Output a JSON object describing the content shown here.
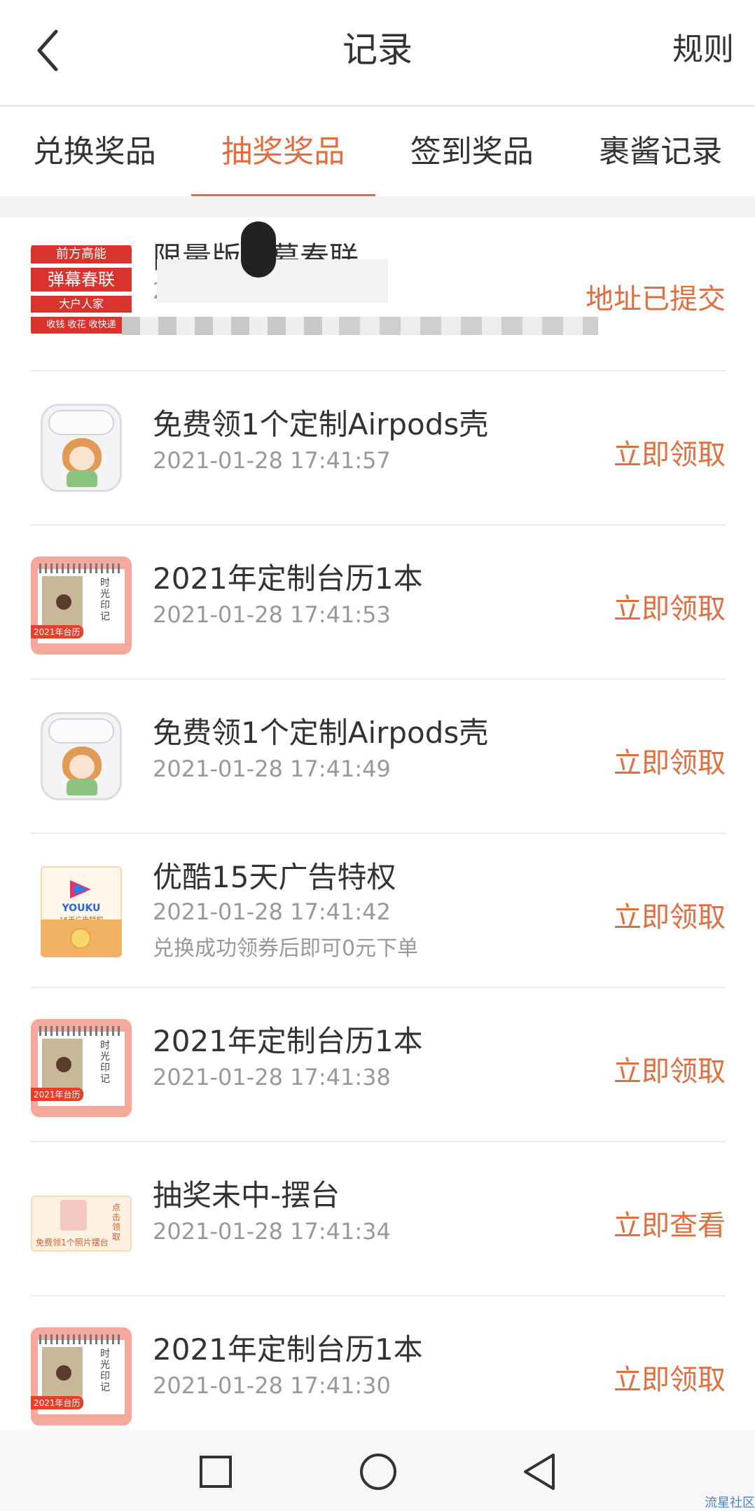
{
  "header": {
    "title": "记录",
    "rules_label": "规则"
  },
  "tabs": [
    {
      "label": "兑换奖品",
      "active": false
    },
    {
      "label": "抽奖奖品",
      "active": true
    },
    {
      "label": "签到奖品",
      "active": false
    },
    {
      "label": "裹酱记录",
      "active": false
    }
  ],
  "items": [
    {
      "image": "couplet",
      "name": "限量版弹幕春联",
      "time": "20",
      "note": "",
      "action": "地址已提交"
    },
    {
      "image": "airpods-case",
      "name": "免费领1个定制Airpods壳",
      "time": "2021-01-28 17:41:57",
      "note": "",
      "action": "立即领取"
    },
    {
      "image": "calendar",
      "name": "2021年定制台历1本",
      "time": "2021-01-28 17:41:53",
      "note": "",
      "action": "立即领取"
    },
    {
      "image": "airpods-case",
      "name": "免费领1个定制Airpods壳",
      "time": "2021-01-28 17:41:49",
      "note": "",
      "action": "立即领取"
    },
    {
      "image": "youku",
      "name": "优酷15天广告特权",
      "time": "2021-01-28 17:41:42",
      "note": "兑换成功领券后即可0元下单",
      "action": "立即领取"
    },
    {
      "image": "calendar",
      "name": "2021年定制台历1本",
      "time": "2021-01-28 17:41:38",
      "note": "",
      "action": "立即领取"
    },
    {
      "image": "photo-stand",
      "name": "抽奖未中-摆台",
      "time": "2021-01-28 17:41:34",
      "note": "",
      "action": "立即查看"
    },
    {
      "image": "calendar",
      "name": "2021年定制台历1本",
      "time": "2021-01-28 17:41:30",
      "note": "",
      "action": "立即领取"
    }
  ],
  "thumbs": {
    "couplet_lines": [
      "前方高能",
      "弹幕春联",
      "大户人家",
      "收钱 收花 收快递"
    ],
    "calendar_tag": "2021年台历",
    "calendar_vertical": "时光印记",
    "youku_brand": "YOUKU",
    "youku_sub": "15天广告特权",
    "stand_text": "免费领1个照片摆台",
    "stand_side": "点击领取"
  },
  "navbar": {
    "icons": [
      "square-icon",
      "circle-icon",
      "triangle-back-icon"
    ]
  },
  "watermark": "流星社区",
  "colors": {
    "accent": "#e26d3f",
    "text": "#333333",
    "muted": "#999999"
  }
}
